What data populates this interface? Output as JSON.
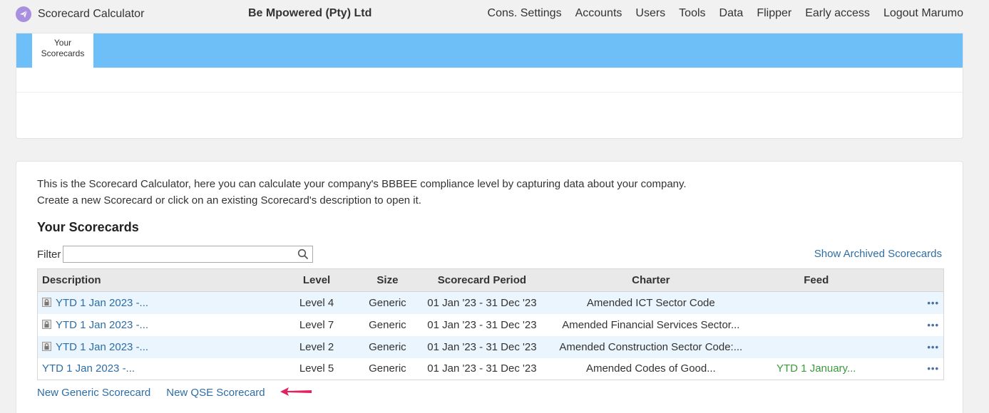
{
  "app": {
    "name": "Scorecard Calculator",
    "company": "Be Mpowered (Pty) Ltd",
    "logo_icon": "paper-plane-icon"
  },
  "nav": [
    {
      "label": "Cons. Settings"
    },
    {
      "label": "Accounts"
    },
    {
      "label": "Users"
    },
    {
      "label": "Tools"
    },
    {
      "label": "Data"
    },
    {
      "label": "Flipper"
    },
    {
      "label": "Early access"
    },
    {
      "label": "Logout Marumo"
    }
  ],
  "tabs": {
    "active_line1": "Your",
    "active_line2": "Scorecards"
  },
  "main": {
    "intro_line1": "This is the Scorecard Calculator, here you can calculate your company's BBBEE compliance level by capturing data about your company.",
    "intro_line2": "Create a new Scorecard or click on an existing Scorecard's description to open it.",
    "title": "Your Scorecards",
    "filter_label": "Filter",
    "filter_value": "",
    "show_archived": "Show Archived Scorecards"
  },
  "table": {
    "headers": [
      "Description",
      "Level",
      "Size",
      "Scorecard Period",
      "Charter",
      "Feed"
    ],
    "rows": [
      {
        "locked": true,
        "description": "YTD 1 Jan 2023 -...",
        "level": "Level 4",
        "size": "Generic",
        "period": "01 Jan '23 - 31 Dec '23",
        "charter": "Amended ICT Sector Code",
        "feed": "",
        "menu": "•••"
      },
      {
        "locked": true,
        "description": "YTD 1 Jan 2023 -...",
        "level": "Level 7",
        "size": "Generic",
        "period": "01 Jan '23 - 31 Dec '23",
        "charter": "Amended Financial Services Sector...",
        "feed": "",
        "menu": "•••"
      },
      {
        "locked": true,
        "description": "YTD 1 Jan 2023 -...",
        "level": "Level 2",
        "size": "Generic",
        "period": "01 Jan '23 - 31 Dec '23",
        "charter": "Amended Construction Sector Code:...",
        "feed": "",
        "menu": "•••"
      },
      {
        "locked": false,
        "description": "YTD 1 Jan 2023 -...",
        "level": "Level 5",
        "size": "Generic",
        "period": "01 Jan '23 - 31 Dec '23",
        "charter": "Amended Codes of Good...",
        "feed": "YTD 1 January...",
        "menu": "•••"
      }
    ]
  },
  "actions": {
    "new_generic": "New Generic Scorecard",
    "new_qse": "New QSE Scorecard"
  },
  "colors": {
    "tab_bar": "#6ebef8",
    "link": "#2e6da4",
    "feed": "#3a9a3a",
    "arrow": "#e0245e",
    "logo": "#a88fe0"
  }
}
